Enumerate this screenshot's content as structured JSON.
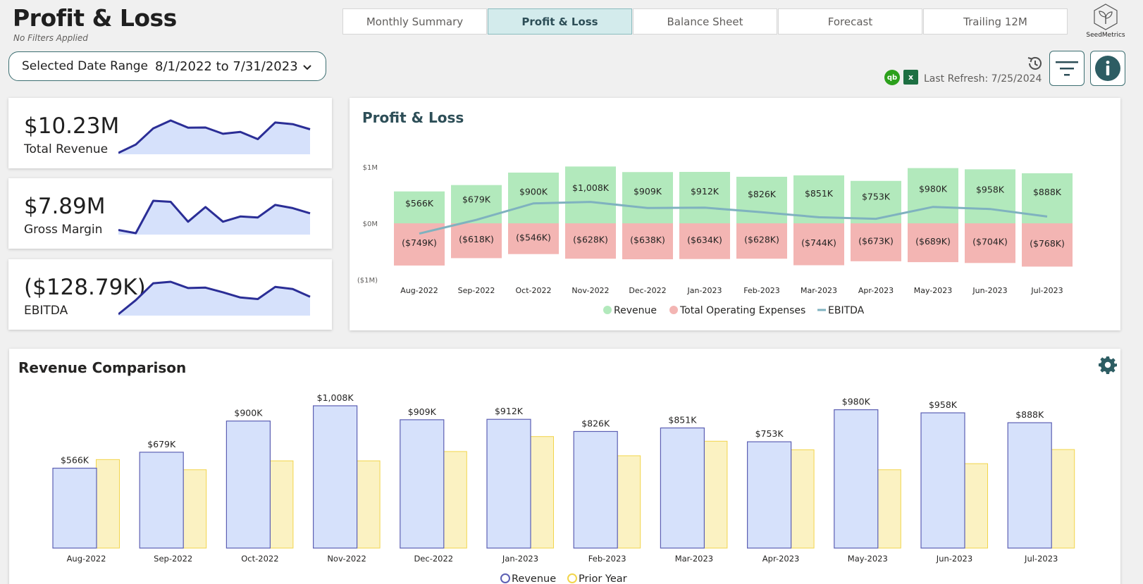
{
  "header": {
    "title": "Profit & Loss",
    "subtitle": "No Filters Applied",
    "logo_text": "SeedMetrics",
    "last_refresh": "Last Refresh: 7/25/2024"
  },
  "tabs": [
    {
      "label": "Monthly Summary",
      "active": false
    },
    {
      "label": "Profit & Loss",
      "active": true
    },
    {
      "label": "Balance Sheet",
      "active": false
    },
    {
      "label": "Forecast",
      "active": false
    },
    {
      "label": "Trailing 12M",
      "active": false
    }
  ],
  "date_range": {
    "label": "Selected Date Range",
    "value": "8/1/2022 to 7/31/2023"
  },
  "icons": {
    "quickbooks": "qb",
    "excel": "x"
  },
  "colors": {
    "accent": "#3c6e71",
    "revenue_green": "#b2e9bc",
    "expense_red": "#f3b5b3",
    "ebitda_line": "#7fb2bf",
    "revenue_blue": "#d6e1fb",
    "revenue_blue_stroke": "#5c5fb3",
    "prior_year": "#fbf2c2",
    "prior_year_stroke": "#f2d54c",
    "spark_line": "#2b2e96",
    "spark_fill": "#d6e1fb"
  },
  "kpis": [
    {
      "value": "$10.23M",
      "label": "Total Revenue",
      "spark": [
        0.566,
        0.679,
        0.9,
        1.008,
        0.909,
        0.912,
        0.826,
        0.851,
        0.753,
        0.98,
        0.958,
        0.888
      ]
    },
    {
      "value": "$7.89M",
      "label": "Gross Margin",
      "spark": [
        0.45,
        0.42,
        0.73,
        0.72,
        0.53,
        0.67,
        0.53,
        0.58,
        0.57,
        0.69,
        0.66,
        0.61
      ]
    },
    {
      "value": "($128.79K)",
      "label": "EBITDA",
      "spark": [
        -0.183,
        0.061,
        0.354,
        0.38,
        0.271,
        0.278,
        0.198,
        0.107,
        0.08,
        0.291,
        0.254,
        0.12
      ]
    }
  ],
  "chart_data": [
    {
      "type": "bar",
      "title": "Profit & Loss",
      "categories": [
        "Aug-2022",
        "Sep-2022",
        "Oct-2022",
        "Nov-2022",
        "Dec-2022",
        "Jan-2023",
        "Feb-2023",
        "Mar-2023",
        "Apr-2023",
        "May-2023",
        "Jun-2023",
        "Jul-2023"
      ],
      "series": [
        {
          "name": "Revenue",
          "values": [
            566,
            679,
            900,
            1008,
            909,
            912,
            826,
            851,
            753,
            980,
            958,
            888
          ],
          "labels": [
            "$566K",
            "$679K",
            "$900K",
            "$1,008K",
            "$909K",
            "$912K",
            "$826K",
            "$851K",
            "$753K",
            "$980K",
            "$958K",
            "$888K"
          ]
        },
        {
          "name": "Total Operating Expenses",
          "values": [
            -749,
            -618,
            -546,
            -628,
            -638,
            -634,
            -628,
            -744,
            -673,
            -689,
            -704,
            -768
          ],
          "labels": [
            "($749K)",
            "($618K)",
            "($546K)",
            "($628K)",
            "($638K)",
            "($634K)",
            "($628K)",
            "($744K)",
            "($673K)",
            "($689K)",
            "($704K)",
            "($768K)"
          ]
        },
        {
          "name": "EBITDA",
          "values": [
            -183,
            61,
            354,
            380,
            271,
            278,
            198,
            107,
            80,
            291,
            254,
            120
          ]
        }
      ],
      "ytick_labels": [
        "$1M",
        "$0M",
        "($1M)"
      ],
      "yticks": [
        1000,
        0,
        -1000
      ],
      "ylim": [
        -1000,
        1000
      ],
      "xlabel": "",
      "ylabel": ""
    },
    {
      "type": "bar",
      "title": "Revenue Comparison",
      "categories": [
        "Aug-2022",
        "Sep-2022",
        "Oct-2022",
        "Nov-2022",
        "Dec-2022",
        "Jan-2023",
        "Feb-2023",
        "Mar-2023",
        "Apr-2023",
        "May-2023",
        "Jun-2023",
        "Jul-2023"
      ],
      "series": [
        {
          "name": "Revenue",
          "values": [
            566,
            679,
            900,
            1008,
            909,
            912,
            826,
            851,
            753,
            980,
            958,
            888
          ],
          "labels": [
            "$566K",
            "$679K",
            "$900K",
            "$1,008K",
            "$909K",
            "$912K",
            "$826K",
            "$851K",
            "$753K",
            "$980K",
            "$958K",
            "$888K"
          ]
        },
        {
          "name": "Prior Year",
          "values": [
            627,
            555,
            618,
            618,
            684,
            790,
            654,
            757,
            696,
            555,
            598,
            698
          ]
        }
      ],
      "ylim": [
        0,
        1100
      ],
      "xlabel": "",
      "ylabel": ""
    }
  ]
}
